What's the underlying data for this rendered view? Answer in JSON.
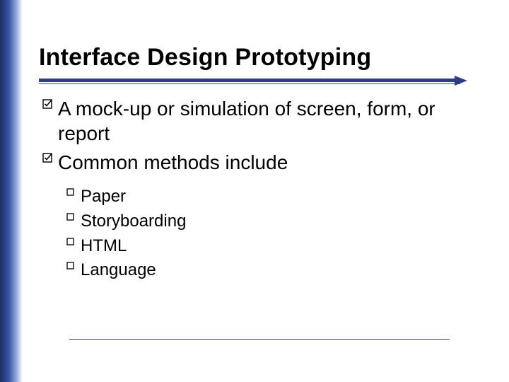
{
  "slide": {
    "title": "Interface Design Prototyping",
    "colors": {
      "accent": "#2a3d86",
      "text": "#000000"
    },
    "bullets_level1": [
      {
        "text": "A mock-up or simulation of screen, form, or report"
      },
      {
        "text": "Common methods include"
      }
    ],
    "bullets_level2": [
      {
        "text": "Paper"
      },
      {
        "text": "Storyboarding"
      },
      {
        "text": "HTML"
      },
      {
        "text": "Language"
      }
    ],
    "icons": {
      "level1_bullet": "checkbox-checked-icon",
      "level2_bullet": "square-outline-icon"
    }
  }
}
